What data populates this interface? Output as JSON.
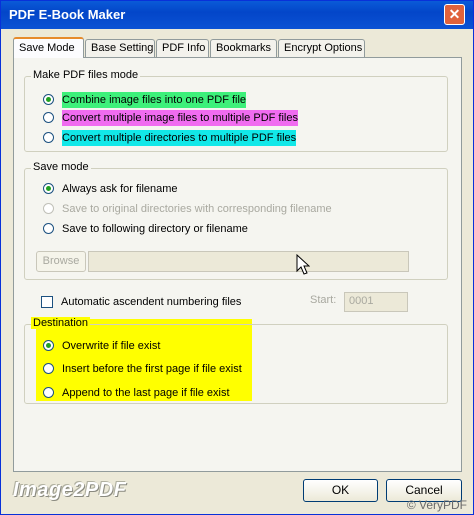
{
  "window": {
    "title": "PDF E-Book Maker"
  },
  "tabs": [
    "Save Mode",
    "Base Setting",
    "PDF Info",
    "Bookmarks",
    "Encrypt Options"
  ],
  "active_tab": 0,
  "pdf_mode": {
    "label": "Make PDF files mode",
    "options": [
      {
        "label": "Combine image files into one PDF file",
        "selected": true,
        "highlight": "#3df07a"
      },
      {
        "label": "Convert multiple image files to multiple PDF files",
        "selected": false,
        "highlight": "#f06cf0"
      },
      {
        "label": "Convert multiple directories to multiple PDF files",
        "selected": false,
        "highlight": "#12e8e8"
      }
    ]
  },
  "save_mode": {
    "label": "Save mode",
    "options": [
      {
        "label": "Always ask for filename",
        "selected": true,
        "disabled": false
      },
      {
        "label": "Save to original directories with corresponding filename",
        "selected": false,
        "disabled": true
      },
      {
        "label": "Save to following directory or filename",
        "selected": false,
        "disabled": false
      }
    ],
    "browse_label": "Browse",
    "path_value": ""
  },
  "numbering": {
    "label": "Automatic ascendent numbering files",
    "checked": false,
    "start_label": "Start:",
    "start_value": "0001"
  },
  "destination": {
    "label": "Destination",
    "highlight": "#ffff00",
    "options": [
      {
        "label": "Overwrite if file exist",
        "selected": true
      },
      {
        "label": "Insert before the first page if file exist",
        "selected": false
      },
      {
        "label": "Append to the last page if file exist",
        "selected": false
      }
    ]
  },
  "footer": {
    "brand": "Image2PDF",
    "ok_label": "OK",
    "cancel_label": "Cancel",
    "watermark": "© VeryPDF"
  },
  "colors": {
    "title_bar": "#0346c9",
    "tab_accent": "#e68b2c",
    "dialog_bg": "#ece9d8"
  }
}
